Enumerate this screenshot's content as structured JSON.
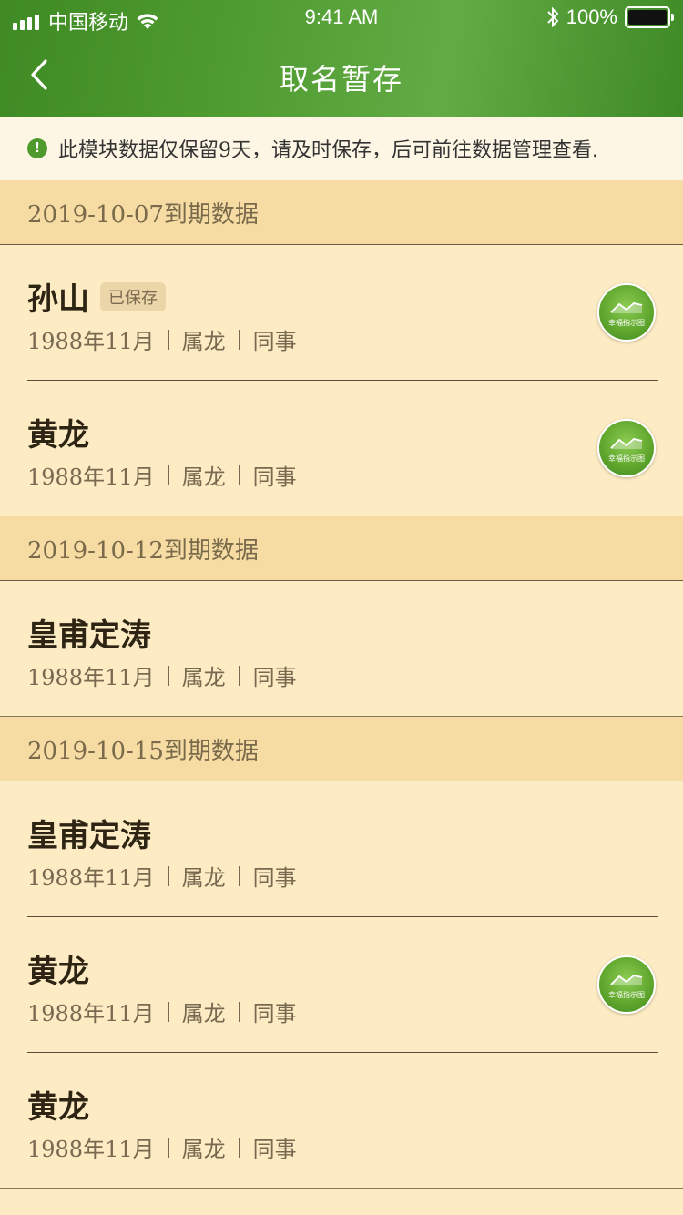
{
  "status_bar": {
    "carrier": "中国移动",
    "time": "9:41 AM",
    "battery": "100%"
  },
  "nav": {
    "title": "取名暂存",
    "back_icon": "chevron-left-icon"
  },
  "notice": {
    "icon": "exclamation-icon",
    "text": "此模块数据仅保留9天，请及时保存，后可前往数据管理查看."
  },
  "colors": {
    "header_green": "#4f9c30",
    "background": "#fdebc4",
    "group_header": "#f6dca3"
  },
  "groups": [
    {
      "title": "2019-10-07到期数据",
      "items": [
        {
          "name": "孙山",
          "badge": "已保存",
          "birth": "1988年11月",
          "zodiac": "属龙",
          "relation": "同事",
          "button_label": "幸福指示图"
        },
        {
          "name": "黄龙",
          "badge": "",
          "birth": "1988年11月",
          "zodiac": "属龙",
          "relation": "同事",
          "button_label": "幸福指示图"
        }
      ]
    },
    {
      "title": "2019-10-12到期数据",
      "items": [
        {
          "name": "皇甫定涛",
          "badge": "",
          "birth": "1988年11月",
          "zodiac": "属龙",
          "relation": "同事",
          "button_label": ""
        }
      ]
    },
    {
      "title": "2019-10-15到期数据",
      "items": [
        {
          "name": "皇甫定涛",
          "badge": "",
          "birth": "1988年11月",
          "zodiac": "属龙",
          "relation": "同事",
          "button_label": ""
        },
        {
          "name": "黄龙",
          "badge": "",
          "birth": "1988年11月",
          "zodiac": "属龙",
          "relation": "同事",
          "button_label": "幸福指示图"
        },
        {
          "name": "黄龙",
          "badge": "",
          "birth": "1988年11月",
          "zodiac": "属龙",
          "relation": "同事",
          "button_label": ""
        }
      ]
    }
  ]
}
